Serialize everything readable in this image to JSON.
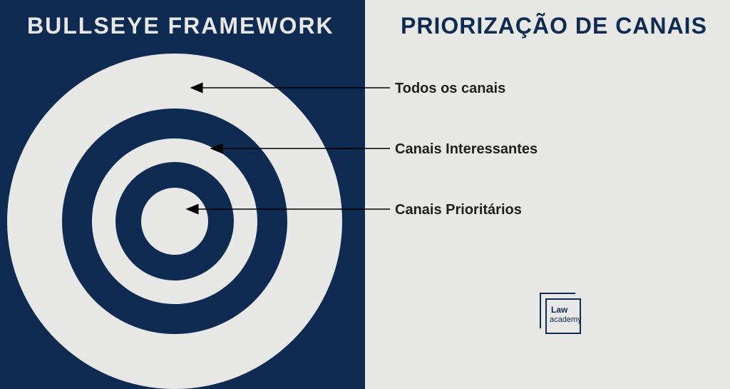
{
  "left": {
    "title": "BULLSEYE FRAMEWORK"
  },
  "right": {
    "title": "PRIORIZAÇÃO DE CANAIS",
    "labels": {
      "outer": "Todos os canais",
      "middle": "Canais Interessantes",
      "inner": "Canais Prioritários"
    }
  },
  "logo": {
    "line1": "Law",
    "line2": "academy"
  },
  "colors": {
    "navy": "#0f2b52",
    "light": "#e7e7e6"
  }
}
